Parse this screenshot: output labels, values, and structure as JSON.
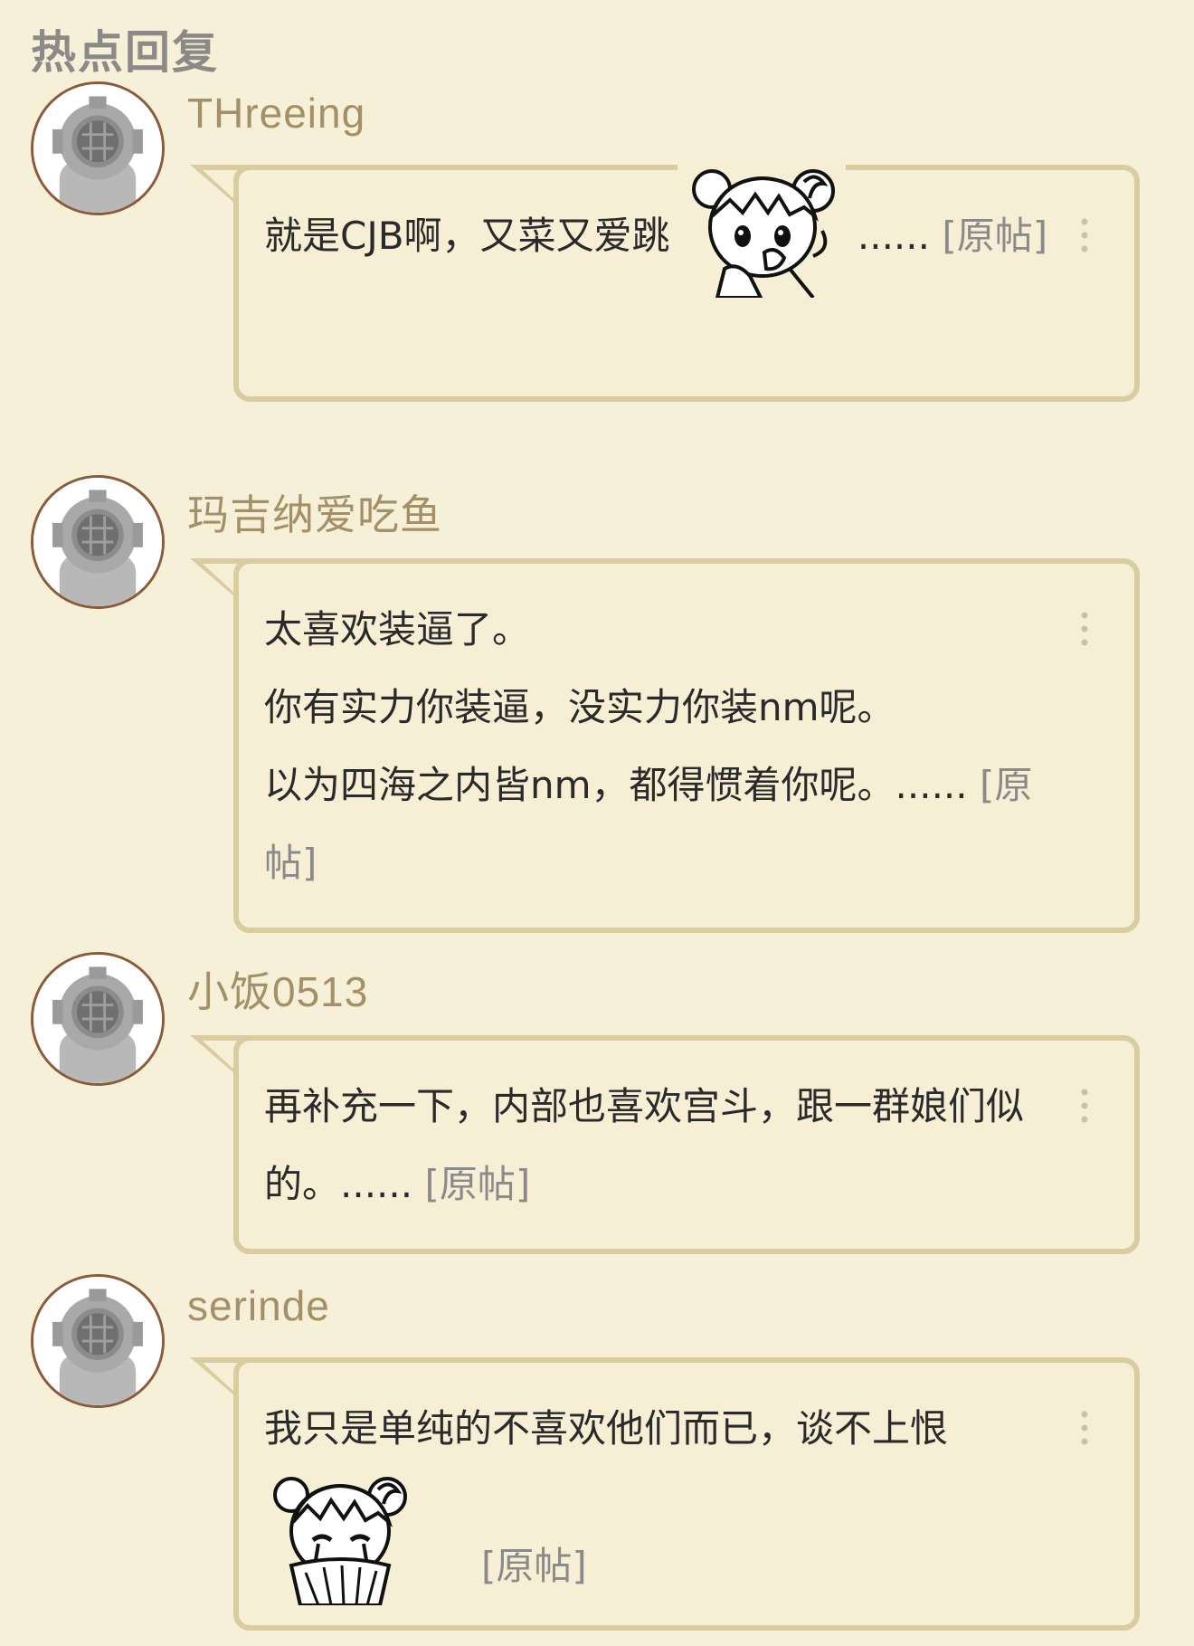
{
  "section": {
    "title": "热点回复"
  },
  "posts": [
    {
      "username": "THreeing",
      "text_before": "就是CJB啊，又菜又爱跳",
      "emoji": "girl-covering-mouth-emoji",
      "text_after": " ......",
      "link_label": " [原帖]"
    },
    {
      "username": "玛吉纳爱吃鱼",
      "lines": [
        "太喜欢装逼了。",
        "你有实力你装逼，没实力你装nm呢。",
        "以为四海之内皆nm，都得惯着你呢。......"
      ],
      "link_label": " [原帖]"
    },
    {
      "username": "小饭0513",
      "text": "再补充一下，内部也喜欢宫斗，跟一群娘们似的。......",
      "link_label": " [原帖]"
    },
    {
      "username": "serinde",
      "text": "我只是单纯的不喜欢他们而已，谈不上恨",
      "emoji": "girl-crying-with-fan-emoji",
      "link_label": "[原帖]"
    }
  ],
  "colors": {
    "background": "#f7f0d8",
    "bubble_bg": "#f6eed5",
    "bubble_border": "#d9cca0",
    "username": "#a39068",
    "title": "#8b8a87",
    "link": "#8a8a8a",
    "avatar_ring": "#8a5a3a"
  },
  "icons": {
    "avatar": "diving-helmet-avatar",
    "more": "vertical-more-icon"
  }
}
